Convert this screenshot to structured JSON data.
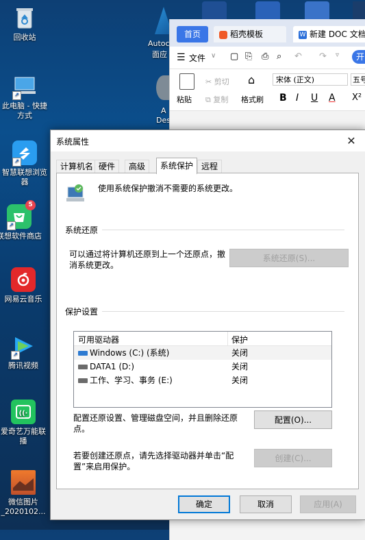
{
  "desktop": {
    "icons": [
      {
        "label": "回收站",
        "icon": "recycle-bin-icon"
      },
      {
        "label": "此电脑 - 快捷方式",
        "icon": "computer-icon"
      },
      {
        "label": "智慧联想浏览器",
        "icon": "browser-icon"
      },
      {
        "label": "联想软件商店",
        "icon": "store-icon",
        "badge": "5"
      },
      {
        "label": "网易云音乐",
        "icon": "music-icon"
      },
      {
        "label": "腾讯视频",
        "icon": "video-icon"
      },
      {
        "label": "爱奇艺万能联播",
        "icon": "iqiyi-icon"
      },
      {
        "label": "微信图片_2020102...",
        "icon": "image-icon"
      }
    ],
    "partial_labels": [
      "Autoc",
      "面应",
      "A",
      "Des"
    ]
  },
  "wps": {
    "tabs": [
      "首页",
      "稻壳模板",
      "新建 DOC 文档"
    ],
    "menu": {
      "file": "文件",
      "start": "开"
    },
    "ribbon": {
      "paste": "粘贴",
      "cut": "剪切",
      "copy": "复制",
      "format_painter": "格式刷",
      "font": "宋体 (正文)",
      "size": "五号",
      "bold": "B",
      "italic": "I",
      "underline": "U",
      "font_color": "A",
      "superscript": "X²"
    }
  },
  "dialog": {
    "title": "系统属性",
    "close": "✕",
    "tabs": [
      "计算机名",
      "硬件",
      "高级",
      "系统保护",
      "远程"
    ],
    "active_tab": "系统保护",
    "intro": "使用系统保护撤消不需要的系统更改。",
    "restore_group": "系统还原",
    "restore_text": "可以通过将计算机还原到上一个还原点，撤消系统更改。",
    "restore_button": "系统还原(S)...",
    "protection_group": "保护设置",
    "columns": [
      "可用驱动器",
      "保护"
    ],
    "drives": [
      {
        "name": "Windows (C:) (系统)",
        "protection": "关闭"
      },
      {
        "name": "DATA1 (D:)",
        "protection": "关闭"
      },
      {
        "name": "工作、学习、事务 (E:)",
        "protection": "关闭"
      }
    ],
    "configure_text": "配置还原设置、管理磁盘空间，并且删除还原点。",
    "configure_button": "配置(O)...",
    "create_text": "若要创建还原点，请先选择驱动器并单击“配置”来启用保护。",
    "create_button": "创建(C)...",
    "ok": "确定",
    "cancel": "取消",
    "apply": "应用(A)"
  }
}
